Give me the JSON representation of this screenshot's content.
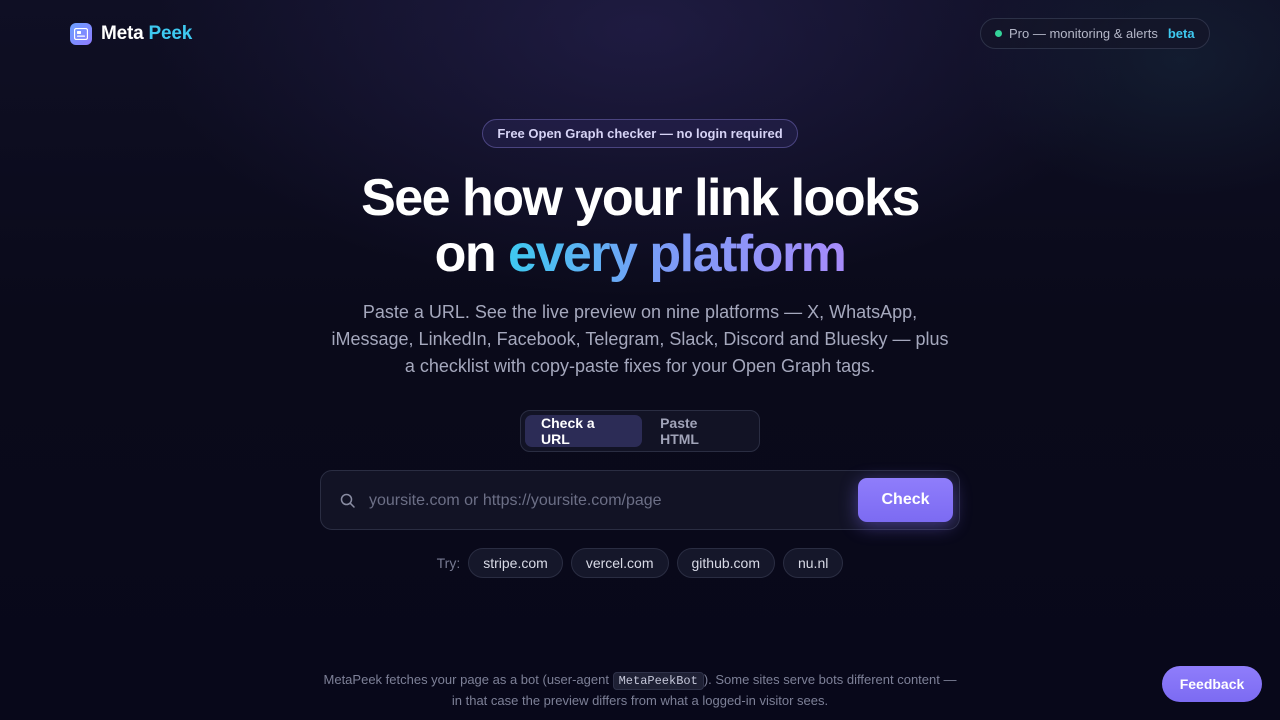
{
  "header": {
    "brand_first": "Meta",
    "brand_second": "Peek",
    "pro_label": "Pro — monitoring & alerts",
    "pro_badge": "beta"
  },
  "hero": {
    "badge": "Free Open Graph checker — no login required",
    "headline_line1": "See how your link looks",
    "headline_line2_prefix": "on",
    "headline_line2_gradient": "every platform",
    "subtitle": "Paste a URL. See the live preview on nine platforms — X, WhatsApp, iMessage, LinkedIn, Facebook, Telegram, Slack, Discord and Bluesky — plus a checklist with copy-paste fixes for your Open Graph tags."
  },
  "tabs": [
    {
      "label": "Check a URL",
      "active": true
    },
    {
      "label": "Paste HTML",
      "active": false
    }
  ],
  "search": {
    "placeholder": "yoursite.com or https://yoursite.com/page",
    "value": "",
    "button_label": "Check"
  },
  "try": {
    "label": "Try:",
    "examples": [
      "stripe.com",
      "vercel.com",
      "github.com",
      "nu.nl"
    ]
  },
  "footer": {
    "note_before": "MetaPeek fetches your page as a bot (user-agent",
    "user_agent": "MetaPeekBot",
    "note_after": "). Some sites serve bots different content — in that case the preview differs from what a logged-in visitor sees."
  },
  "feedback_label": "Feedback",
  "colors": {
    "accent": "#8f7dfb",
    "brand_cyan": "#3ec9f0",
    "status_green": "#34d399",
    "background": "#0a0a1a"
  },
  "icons": {
    "logo": "preview-card-icon",
    "search": "search-icon",
    "status": "status-dot-icon"
  }
}
